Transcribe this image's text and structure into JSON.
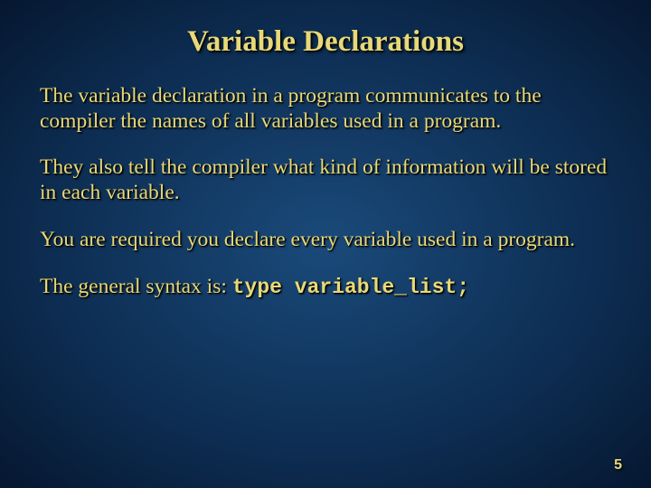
{
  "slide": {
    "title": "Variable Declarations",
    "paragraphs": [
      "The variable declaration in a program communicates to the compiler the names of all variables used in a program.",
      "They also tell the compiler what kind of information will be stored in each variable.",
      "You are required you declare every variable used in a program."
    ],
    "syntax_prefix": "The general syntax is: ",
    "syntax_code": "type  variable_list;",
    "page_number": "5"
  }
}
